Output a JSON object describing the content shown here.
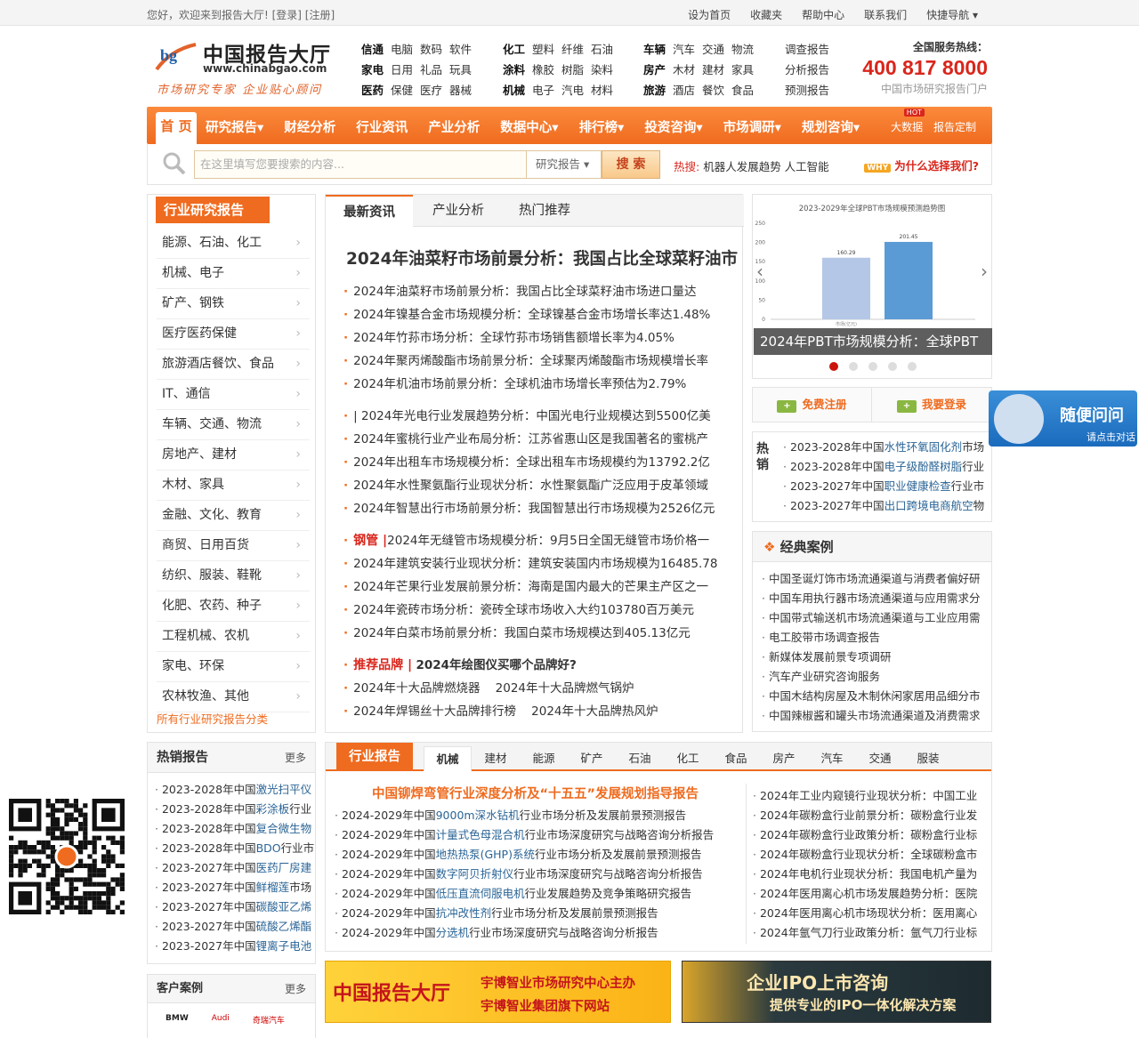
{
  "topbar": {
    "welcome": "您好，欢迎来到报告大厅! [登录] [注册]",
    "links": [
      "设为首页",
      "收藏夹",
      "帮助中心",
      "联系我们",
      "快捷导航"
    ]
  },
  "logo": {
    "name": "中国报告大厅",
    "url": "www.chinabgao.com",
    "slogan": "市场研究专家 企业贴心顾问"
  },
  "categories": {
    "col1": [
      [
        "信通",
        "电脑",
        "数码",
        "软件"
      ],
      [
        "家电",
        "日用",
        "礼品",
        "玩具"
      ],
      [
        "医药",
        "保健",
        "医疗",
        "器械"
      ]
    ],
    "col2": [
      [
        "化工",
        "塑料",
        "纤维",
        "石油"
      ],
      [
        "涂料",
        "橡胶",
        "树脂",
        "染料"
      ],
      [
        "机械",
        "电子",
        "汽电",
        "材料"
      ]
    ],
    "col3": [
      [
        "车辆",
        "汽车",
        "交通",
        "物流"
      ],
      [
        "房产",
        "木材",
        "建材",
        "家具"
      ],
      [
        "旅游",
        "酒店",
        "餐饮",
        "食品"
      ]
    ],
    "col4": [
      "调查报告",
      "分析报告",
      "预测报告"
    ]
  },
  "hotline": {
    "label": "全国服务热线：",
    "number": "400 817 8000",
    "sub": "中国市场研究报告门户"
  },
  "nav": {
    "home": "首 页",
    "items": [
      "研究报告▾",
      "财经分析",
      "行业资讯",
      "产业分析",
      "数据中心▾",
      "排行榜▾",
      "投资咨询▾",
      "市场调研▾",
      "规划咨询▾"
    ],
    "hot_badge": "HOT",
    "extra": [
      "大数据",
      "报告定制"
    ]
  },
  "search": {
    "placeholder": "在这里填写您要搜索的内容...",
    "select": "研究报告",
    "button": "搜 索",
    "hot_label": "热搜:",
    "hot_words": "机器人发展趋势  人工智能",
    "why_badge": "WHY",
    "why": "为什么选择我们?"
  },
  "industry": {
    "title": "行业研究报告",
    "items": [
      "能源、石油、化工",
      "机械、电子",
      "矿产、钢铁",
      "医疗医药保健",
      "旅游酒店餐饮、食品",
      "IT、通信",
      "车辆、交通、物流",
      "房地产、建材",
      "木材、家具",
      "金融、文化、教育",
      "商贸、日用百货",
      "纺织、服装、鞋靴",
      "化肥、农药、种子",
      "工程机械、农机",
      "家电、环保",
      "农林牧渔、其他"
    ],
    "all": "所有行业研究报告分类"
  },
  "news": {
    "tabs": [
      "最新资讯",
      "产业分析",
      "热门推荐"
    ],
    "headline": "2024年油菜籽市场前景分析：我国占比全球菜籽油市",
    "group1": [
      "2024年油菜籽市场前景分析：我国占比全球菜籽油市场进口量达",
      "2024年镍基合金市场规模分析：全球镍基合金市场增长率达1.48%",
      "2024年竹荪市场分析：全球竹荪市场销售额增长率为4.05%",
      "2024年聚丙烯酸酯市场前景分析：全球聚丙烯酸酯市场规模增长率",
      "2024年机油市场前景分析：全球机油市场增长率预估为2.79%"
    ],
    "group2": [
      "| 2024年光电行业发展趋势分析：中国光电行业规模达到5500亿美",
      "2024年蜜桃行业产业布局分析：江苏省惠山区是我国著名的蜜桃产",
      "2024年出租车市场规模分析：全球出租车市场规模约为13792.2亿",
      "2024年水性聚氨酯行业现状分析：水性聚氨酯广泛应用于皮革领域",
      "2024年智慧出行市场前景分析：我国智慧出行市场规模为2526亿元"
    ],
    "group3_tag": "钢管 |",
    "group3": [
      "2024年无缝管市场规模分析：9月5日全国无缝管市场价格一",
      "2024年建筑安装行业现状分析：建筑安装国内市场规模为16485.78",
      "2024年芒果行业发展前景分析：海南是国内最大的芒果主产区之一",
      "2024年瓷砖市场分析：瓷砖全球市场收入大约103780百万美元",
      "2024年白菜市场前景分析：我国白菜市场规模达到405.13亿元"
    ],
    "brand_tag": "推荐品牌 |",
    "brand_head": "2024年绘图仪买哪个品牌好?",
    "brand_rows": [
      "2024年十大品牌燃烧器    2024年十大品牌燃气锅炉",
      "2024年焊锡丝十大品牌排行榜    2024年十大品牌热风炉"
    ]
  },
  "slider": {
    "chart_title": "2023-2029年全球PBT市场规模预测趋势图",
    "caption": "2024年PBT市场规模分析：全球PBT",
    "ticks": [
      "250",
      "200",
      "150",
      "100",
      "50",
      "0"
    ],
    "xlabel": "市场(亿元)"
  },
  "chart_data": {
    "type": "bar",
    "title": "2023-2029年全球PBT市场规模预测趋势图",
    "categories": [
      "",
      ""
    ],
    "values": [
      160.29,
      201.45
    ],
    "ylim": [
      0,
      250
    ],
    "labels": [
      "160.29",
      "201.45"
    ],
    "colors": [
      "#b4c7e7",
      "#5b9bd5"
    ]
  },
  "reg": {
    "register": "免费注册",
    "login": "我要登录"
  },
  "hotsale": {
    "label": "热销",
    "items": [
      [
        "2023-2028年中国",
        "水性环氧固化剂",
        "市场"
      ],
      [
        "2023-2028年中国",
        "电子级酚醛树脂",
        "行业"
      ],
      [
        "2023-2027年中国",
        "职业健康检查",
        "行业市"
      ],
      [
        "2023-2027年中国",
        "出口跨境电商航空",
        "物"
      ]
    ]
  },
  "classic": {
    "title": "经典案例",
    "items": [
      "中国圣诞灯饰市场流通渠道与消费者偏好研",
      "中国车用执行器市场流通渠道与应用需求分",
      "中国带式输送机市场流通渠道与工业应用需",
      "电工胶带市场调查报告",
      "新媒体发展前景专项调研",
      "汽车产业研究咨询服务",
      "中国木结构房屋及木制休闲家居用品细分市",
      "中国辣椒酱和罐头市场流通渠道及消费需求"
    ]
  },
  "float": {
    "t1": "随便问问",
    "t2": "请点击对话"
  },
  "hotrep": {
    "title": "热销报告",
    "more": "更多",
    "items": [
      [
        "2023-2028年中国",
        "激光扫平仪"
      ],
      [
        "2023-2028年中国",
        "彩涂板",
        "行业"
      ],
      [
        "2023-2028年中国",
        "复合微生物"
      ],
      [
        "2023-2028年中国",
        "BDO",
        "行业市"
      ],
      [
        "2023-2027年中国",
        "医药厂房建"
      ],
      [
        "2023-2027年中国",
        "鲜榴莲",
        "市场"
      ],
      [
        "2023-2027年中国",
        "碳酸亚乙烯"
      ],
      [
        "2023-2027年中国",
        "硫酸乙烯酯"
      ],
      [
        "2023-2027年中国",
        "锂离子电池"
      ]
    ]
  },
  "cust": {
    "title": "客户案例",
    "more": "更多",
    "logos": [
      "BMW",
      "Audi",
      "奇瑞汽车"
    ]
  },
  "indrep": {
    "title": "行业报告",
    "tabs": [
      "机械",
      "建材",
      "能源",
      "矿产",
      "石油",
      "化工",
      "食品",
      "房产",
      "汽车",
      "交通",
      "服装"
    ],
    "feature": "中国铆焊弯管行业深度分析及“十五五”发展规划指导报告",
    "left": [
      [
        "2024-2029年中国",
        "9000m深水钻机",
        "行业市场分析及发展前景预测报告"
      ],
      [
        "2024-2029年中国",
        "计量式色母混合机",
        "行业市场深度研究与战略咨询分析报告"
      ],
      [
        "2024-2029年中国",
        "地热热泵(GHP)系统",
        "行业市场分析及发展前景预测报告"
      ],
      [
        "2024-2029年中国",
        "数字阿贝折射仪",
        "行业市场深度研究与战略咨询分析报告"
      ],
      [
        "2024-2029年中国",
        "低压直流伺服电机",
        "行业发展趋势及竞争策略研究报告"
      ],
      [
        "2024-2029年中国",
        "抗冲改性剂",
        "行业市场分析及发展前景预测报告"
      ],
      [
        "2024-2029年中国",
        "分选机",
        "行业市场深度研究与战略咨询分析报告"
      ]
    ],
    "right": [
      "2024年工业内窥镜行业现状分析：中国工业",
      "2024年碳粉盒行业前景分析：碳粉盒行业发",
      "2024年碳粉盒行业政策分析：碳粉盒行业标",
      "2024年碳粉盒行业现状分析：全球碳粉盒市",
      "2024年电机行业现状分析：我国电机产量为",
      "2024年医用离心机市场发展趋势分析：医院",
      "2024年医用离心机市场现状分析：医用离心",
      "2024年氩气刀行业政策分析：氩气刀行业标"
    ]
  },
  "banner1": {
    "a": "中国报告大厅",
    "b1": "宇博智业市场研究中心主办",
    "b2": "宇博智业集团旗下网站"
  },
  "banner2": {
    "a": "企业IPO上市咨询",
    "b": "提供专业的IPO一体化解决方案"
  }
}
